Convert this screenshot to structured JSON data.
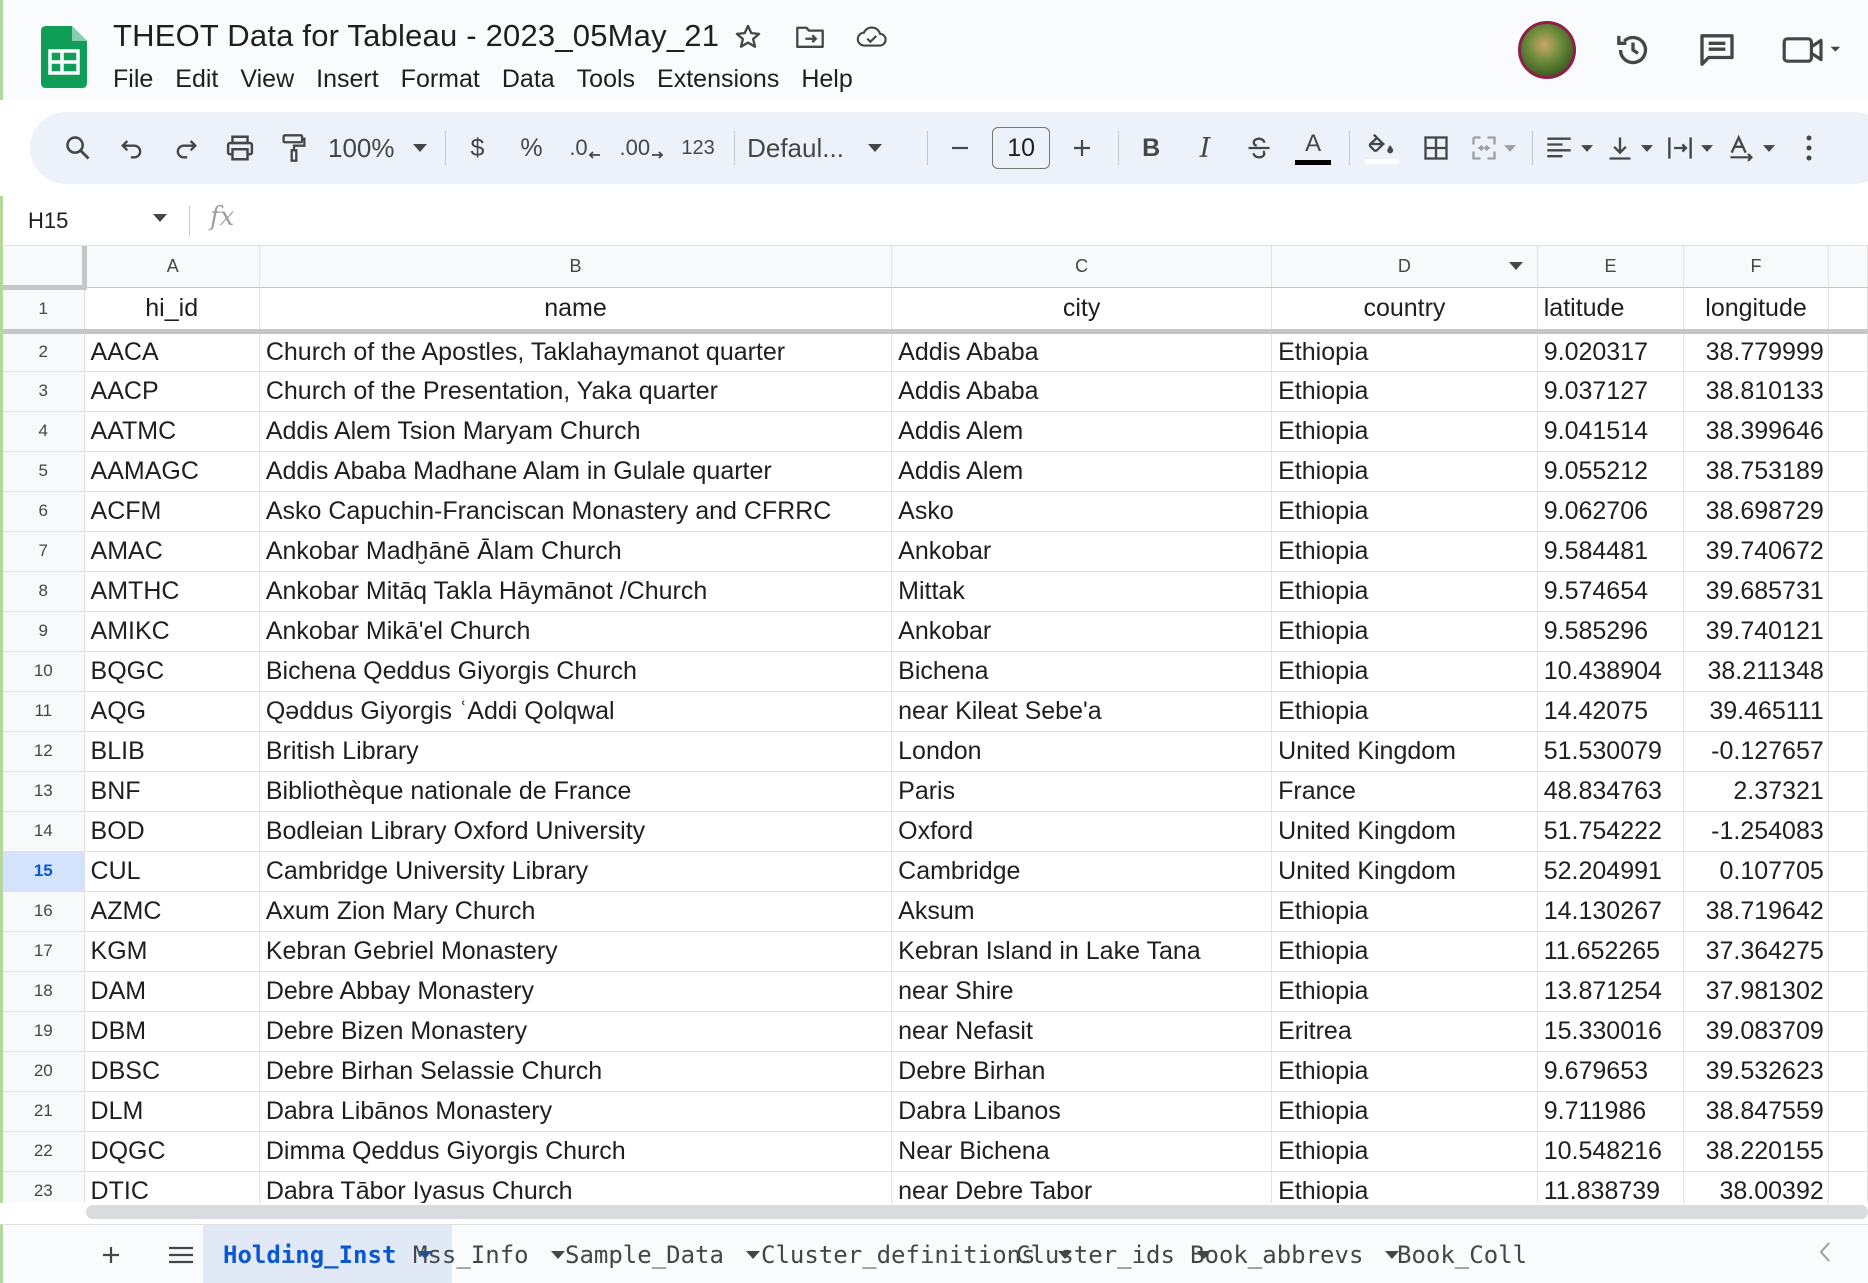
{
  "doc": {
    "title": "THEOT Data for Tableau - 2023_05May_21",
    "menu": [
      "File",
      "Edit",
      "View",
      "Insert",
      "Format",
      "Data",
      "Tools",
      "Extensions",
      "Help"
    ]
  },
  "toolbar": {
    "zoom": "100%",
    "currency": "$",
    "percent": "%",
    "dec_decrease": ".0",
    "dec_increase": ".00",
    "more_formats": "123",
    "font": "Defaul...",
    "font_size": "10",
    "bold": "B",
    "italic": "I",
    "text_color_glyph": "A"
  },
  "formula_bar": {
    "cell_ref": "H15",
    "fx": "fx"
  },
  "grid": {
    "columns": [
      "A",
      "B",
      "C",
      "D",
      "E",
      "F"
    ],
    "header_row": [
      "hi_id",
      "name",
      "city",
      "country",
      "latitude",
      "longitude"
    ],
    "selected_row": 15,
    "rows": [
      {
        "n": "2",
        "id": "AACA",
        "name": "Church of the Apostles, Taklahaymanot quarter",
        "city": "Addis Ababa",
        "country": "Ethiopia",
        "lat": "9.020317",
        "lon": "38.779999"
      },
      {
        "n": "3",
        "id": "AACP",
        "name": "Church of the Presentation, Yaka quarter",
        "city": "Addis Ababa",
        "country": "Ethiopia",
        "lat": "9.037127",
        "lon": "38.810133"
      },
      {
        "n": "4",
        "id": "AATMC",
        "name": "Addis Alem Tsion Maryam Church",
        "city": "Addis Alem",
        "country": "Ethiopia",
        "lat": "9.041514",
        "lon": "38.399646"
      },
      {
        "n": "5",
        "id": "AAMAGC",
        "name": "Addis Ababa Madhane Alam in Gulale quarter",
        "city": "Addis Alem",
        "country": "Ethiopia",
        "lat": "9.055212",
        "lon": "38.753189"
      },
      {
        "n": "6",
        "id": "ACFM",
        "name": "Asko Capuchin-Franciscan Monastery and CFRRC",
        "city": "Asko",
        "country": "Ethiopia",
        "lat": "9.062706",
        "lon": "38.698729"
      },
      {
        "n": "7",
        "id": "AMAC",
        "name": "Ankobar Madḫānē Ālam Church",
        "city": "Ankobar",
        "country": "Ethiopia",
        "lat": "9.584481",
        "lon": "39.740672"
      },
      {
        "n": "8",
        "id": "AMTHC",
        "name": "Ankobar Mitāq Takla Hāymānot /Church",
        "city": "Mittak",
        "country": "Ethiopia",
        "lat": "9.574654",
        "lon": "39.685731"
      },
      {
        "n": "9",
        "id": "AMIKC",
        "name": "Ankobar Mikā'el Church",
        "city": "Ankobar",
        "country": "Ethiopia",
        "lat": "9.585296",
        "lon": "39.740121"
      },
      {
        "n": "10",
        "id": "BQGC",
        "name": "Bichena Qeddus Giyorgis Church",
        "city": "Bichena",
        "country": "Ethiopia",
        "lat": "10.438904",
        "lon": "38.211348"
      },
      {
        "n": "11",
        "id": "AQG",
        "name": "Qəddus Giyorgis ʿAddi Qolqwal",
        "city": "near Kileat Sebe'a",
        "country": "Ethiopia",
        "lat": "14.42075",
        "lon": "39.465111"
      },
      {
        "n": "12",
        "id": "BLIB",
        "name": "British Library",
        "city": "London",
        "country": "United Kingdom",
        "lat": "51.530079",
        "lon": "-0.127657"
      },
      {
        "n": "13",
        "id": "BNF",
        "name": "Bibliothèque nationale de France",
        "city": "Paris",
        "country": "France",
        "lat": "48.834763",
        "lon": "2.37321"
      },
      {
        "n": "14",
        "id": "BOD",
        "name": "Bodleian Library Oxford University",
        "city": "Oxford",
        "country": "United Kingdom",
        "lat": "51.754222",
        "lon": "-1.254083"
      },
      {
        "n": "15",
        "id": "CUL",
        "name": "Cambridge University Library",
        "city": "Cambridge",
        "country": "United Kingdom",
        "lat": "52.204991",
        "lon": "0.107705"
      },
      {
        "n": "16",
        "id": "AZMC",
        "name": "Axum Zion Mary Church",
        "city": "Aksum",
        "country": "Ethiopia",
        "lat": "14.130267",
        "lon": "38.719642"
      },
      {
        "n": "17",
        "id": "KGM",
        "name": "Kebran Gebriel Monastery",
        "city": "Kebran Island in Lake Tana",
        "country": "Ethiopia",
        "lat": "11.652265",
        "lon": "37.364275"
      },
      {
        "n": "18",
        "id": "DAM",
        "name": "Debre Abbay Monastery",
        "city": "near Shire",
        "country": "Ethiopia",
        "lat": "13.871254",
        "lon": "37.981302"
      },
      {
        "n": "19",
        "id": "DBM",
        "name": "Debre Bizen Monastery",
        "city": "near Nefasit",
        "country": "Eritrea",
        "lat": "15.330016",
        "lon": "39.083709"
      },
      {
        "n": "20",
        "id": "DBSC",
        "name": "Debre Birhan Selassie Church",
        "city": "Debre Birhan",
        "country": "Ethiopia",
        "lat": "9.679653",
        "lon": "39.532623"
      },
      {
        "n": "21",
        "id": "DLM",
        "name": "Dabra Libānos Monastery",
        "city": "Dabra Libanos",
        "country": "Ethiopia",
        "lat": "9.711986",
        "lon": "38.847559"
      },
      {
        "n": "22",
        "id": "DQGC",
        "name": "Dimma Qeddus Giyorgis Church",
        "city": "Near Bichena",
        "country": "Ethiopia",
        "lat": "10.548216",
        "lon": "38.220155"
      },
      {
        "n": "23",
        "id": "DTIC",
        "name": "Dabra Tābor Iyasus Church",
        "city": "near Debre Tabor",
        "country": "Ethiopia",
        "lat": "11.838739",
        "lon": "38.00392"
      }
    ]
  },
  "sheets": {
    "tabs": [
      "Holding_Inst",
      "Mss_Info",
      "Sample_Data",
      "Cluster_definitions",
      "Cluster_ids",
      "Book_abbrevs",
      "Book_Coll"
    ],
    "active": "Holding_Inst"
  },
  "colors": {
    "accent": "#0b57d0",
    "sheets_green": "#0f9d58",
    "toolbar_bg": "#edf2fa",
    "selection": "#d3e3fd"
  },
  "icons": [
    "sheets-logo-icon",
    "star-icon",
    "move-folder-icon",
    "cloud-saved-icon",
    "version-history-icon",
    "comments-icon",
    "meet-icon",
    "search-icon",
    "undo-icon",
    "redo-icon",
    "print-icon",
    "paint-format-icon",
    "fill-color-icon",
    "borders-icon",
    "merge-cells-icon",
    "align-left-icon",
    "valign-bottom-icon",
    "text-wrap-icon",
    "text-rotation-icon",
    "add-sheet-icon",
    "all-sheets-icon"
  ]
}
